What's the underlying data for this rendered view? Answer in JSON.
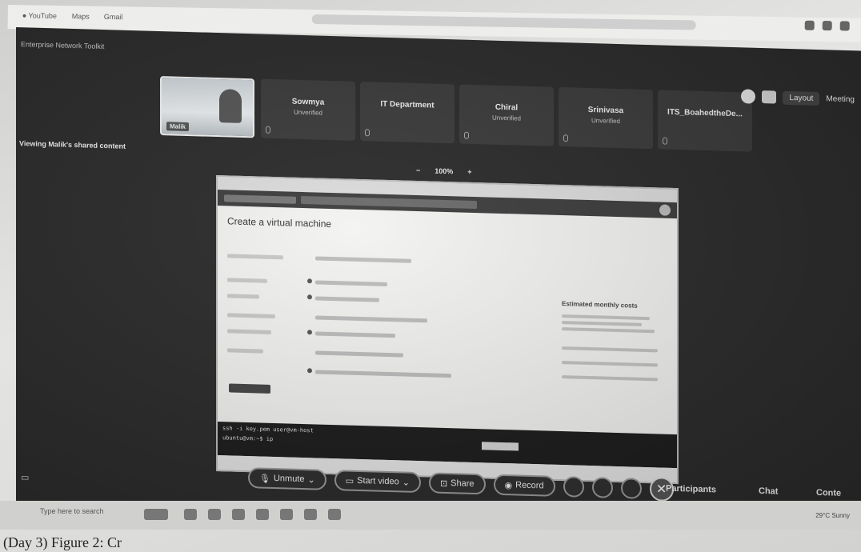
{
  "window": {
    "title": "Enterprise Network Toolkit"
  },
  "shared_label": "Viewing Malik's shared content",
  "participants": [
    {
      "name": "Malik",
      "status": "",
      "video": true
    },
    {
      "name": "Sowmya",
      "status": "Unverified"
    },
    {
      "name": "IT Department",
      "status": ""
    },
    {
      "name": "Chiral",
      "status": "Unverified"
    },
    {
      "name": "Srinivasa",
      "status": "Unverified"
    },
    {
      "name": "ITS_BoahedtheDe...",
      "status": ""
    }
  ],
  "top_controls": {
    "layout": "Layout",
    "meeting": "Meeting"
  },
  "zoom": {
    "minus": "−",
    "level": "100%",
    "plus": "+"
  },
  "shared_content": {
    "page_title": "Create a virtual machine",
    "summary_title": "Estimated monthly costs",
    "terminal_lines": [
      "ssh -i key.pem user@vm-host",
      "ubuntu@vm:~$ ip"
    ]
  },
  "toolbar": {
    "unmute": "Unmute",
    "start_video": "Start video",
    "share": "Share",
    "record": "Record",
    "end": "✕",
    "participants": "Participants",
    "chat": "Chat",
    "more": "Conte"
  },
  "taskbar": {
    "search": "Type here to search",
    "tray": "29°C Sunny"
  },
  "caption": "(Day 3) Figure 2: Cr"
}
